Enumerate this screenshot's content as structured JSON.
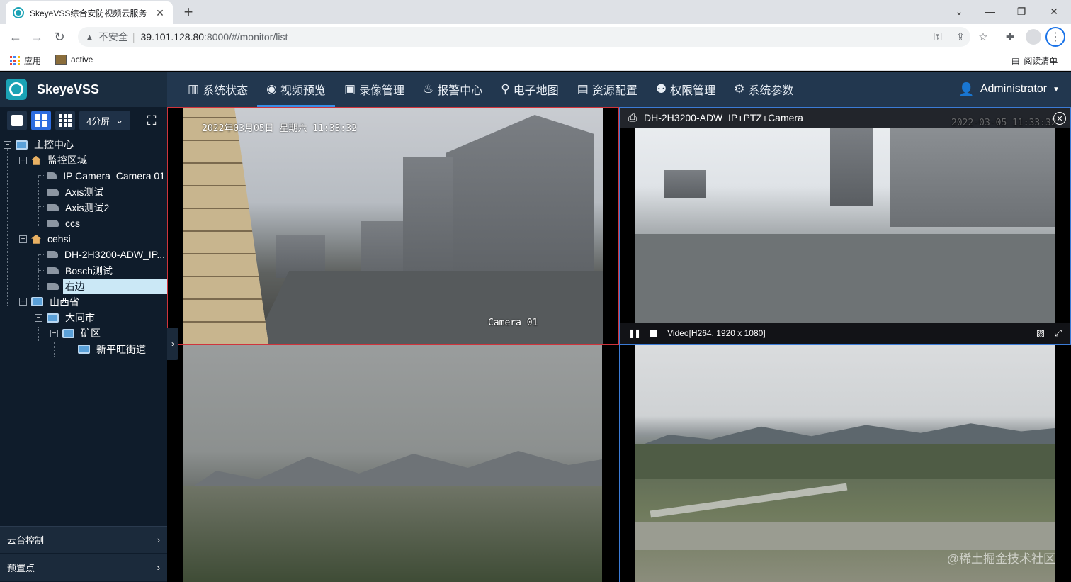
{
  "browser": {
    "tab_title": "SkeyeVSS综合安防视频云服务",
    "tab_close": "✕",
    "new_tab": "+",
    "address": {
      "warning_label": "不安全",
      "separator": "|",
      "host": "39.101.128.80",
      "path": ":8000/#/monitor/list"
    },
    "bookmarks": [
      {
        "label": "应用"
      },
      {
        "label": "active"
      }
    ],
    "reading_list": "阅读清单"
  },
  "app": {
    "brand_name": "SkeyeVSS",
    "nav": [
      {
        "label": "系统状态",
        "icon": "chart-icon",
        "glyph": "▥"
      },
      {
        "label": "视频预览",
        "icon": "eye-icon",
        "glyph": "◉",
        "active": true
      },
      {
        "label": "录像管理",
        "icon": "video-box-icon",
        "glyph": "▣"
      },
      {
        "label": "报警中心",
        "icon": "alarm-icon",
        "glyph": "♨"
      },
      {
        "label": "电子地图",
        "icon": "map-pin-icon",
        "glyph": "⚲"
      },
      {
        "label": "资源配置",
        "icon": "columns-icon",
        "glyph": "▤"
      },
      {
        "label": "权限管理",
        "icon": "user-lock-icon",
        "glyph": "⚉"
      },
      {
        "label": "系统参数",
        "icon": "gear-icon",
        "glyph": "⚙"
      }
    ],
    "user": "Administrator",
    "accent": "#3a8ee6"
  },
  "sidebar": {
    "split_label": "4分屏",
    "tree": {
      "root": "主控中心",
      "area1": "监控区域",
      "area1_items": [
        "IP Camera_Camera 01",
        "Axis测试",
        "Axis测试2",
        "ccs"
      ],
      "area2": "cehsi",
      "area2_items": [
        "DH-2H3200-ADW_IP...",
        "Bosch测试",
        "右边"
      ],
      "province": "山西省",
      "city": "大同市",
      "district": "矿区",
      "street": "新平旺街道"
    },
    "panels": {
      "ptz": "云台控制",
      "preset": "预置点"
    }
  },
  "videos": {
    "cell1": {
      "timestamp": "2022年03月05日  星期六  11:33:32",
      "camera_label": "Camera 01"
    },
    "cell2": {
      "title": "DH-2H3200-ADW_IP+PTZ+Camera",
      "faint_time": "2022-03-05 11:33:32",
      "stream_info": "Video[H264, 1920 x 1080]"
    },
    "watermark": "@稀土掘金技术社区"
  }
}
